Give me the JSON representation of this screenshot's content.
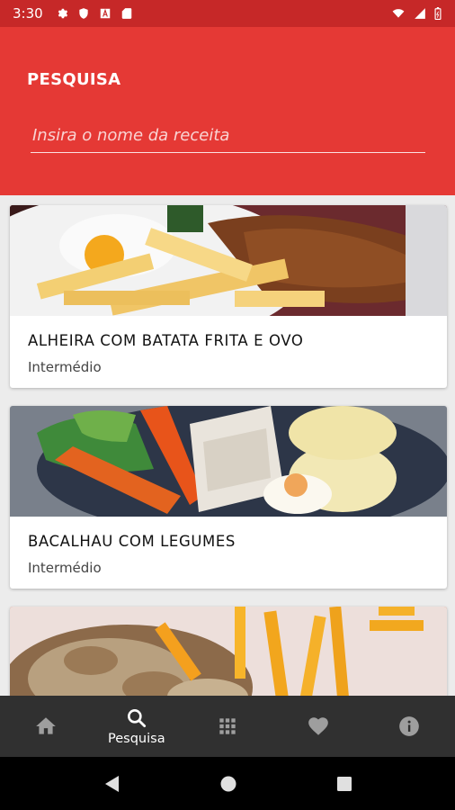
{
  "status": {
    "time": "3:30"
  },
  "header": {
    "title": "PESQUISA",
    "search_placeholder": "Insira o nome da receita",
    "search_value": ""
  },
  "recipes": [
    {
      "title": "ALHEIRA COM BATATA FRITA E OVO",
      "level": "Intermédio",
      "image": "alheira-photo"
    },
    {
      "title": "BACALHAU COM LEGUMES",
      "level": "Intermédio",
      "image": "bacalhau-photo"
    },
    {
      "title": "",
      "level": "",
      "image": "steak-mushroom-fries-photo"
    }
  ],
  "bottom_nav": {
    "items": [
      {
        "icon": "home-icon",
        "label": ""
      },
      {
        "icon": "search-icon",
        "label": "Pesquisa"
      },
      {
        "icon": "grid-icon",
        "label": ""
      },
      {
        "icon": "heart-icon",
        "label": ""
      },
      {
        "icon": "info-icon",
        "label": ""
      }
    ],
    "active_index": 1
  },
  "colors": {
    "status_bar": "#c62828",
    "header": "#e53935",
    "nav": "#303030"
  }
}
